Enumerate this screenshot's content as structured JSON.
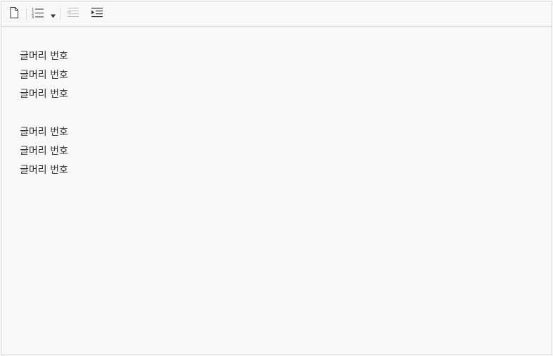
{
  "toolbar": {
    "buttons": [
      {
        "icon": "new-document-icon"
      },
      {
        "icon": "numbered-list-icon"
      },
      {
        "icon": "dropdown-arrow-icon"
      },
      {
        "icon": "outdent-icon",
        "disabled": true
      },
      {
        "icon": "indent-icon"
      }
    ]
  },
  "editor": {
    "paragraphs": [
      {
        "lines": [
          "글머리 번호",
          "글머리 번호",
          "글머리 번호"
        ]
      },
      {
        "lines": [
          "글머리 번호",
          "글머리 번호",
          "글머리 번호"
        ]
      }
    ]
  },
  "colors": {
    "text": "#333333",
    "background": "#f8f8f8",
    "border": "#cfcfcf",
    "icon": "#333333",
    "icon_disabled": "#bbbbbb"
  }
}
